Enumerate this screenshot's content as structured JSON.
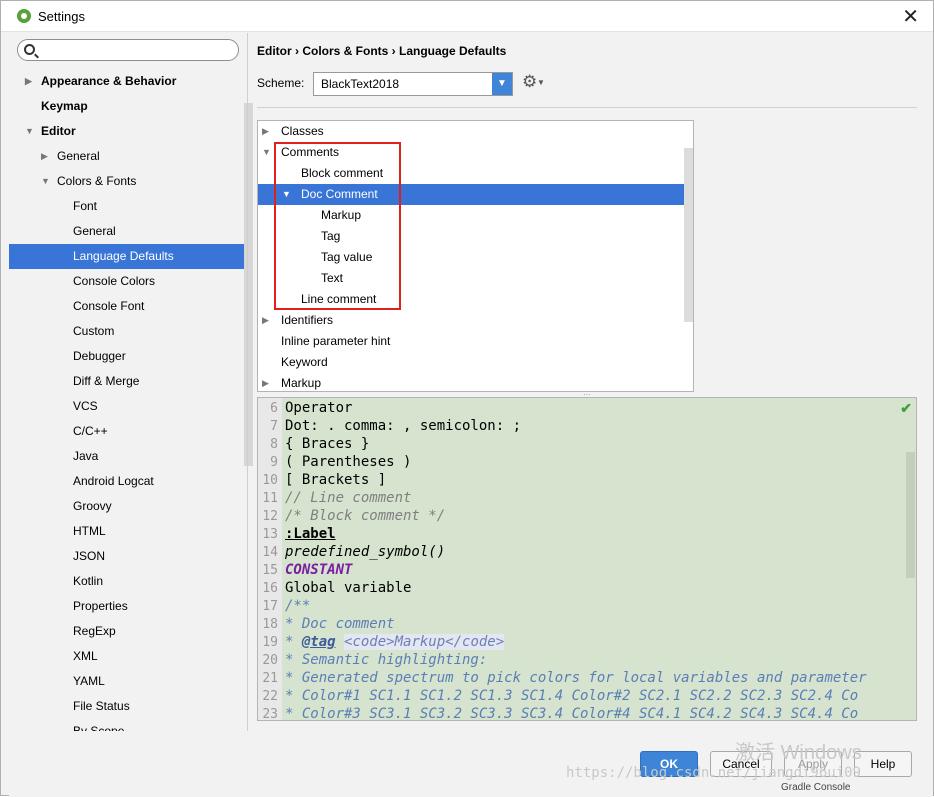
{
  "window": {
    "title": "Settings"
  },
  "search": {
    "placeholder": ""
  },
  "sidebar": {
    "items": [
      {
        "label": "Appearance & Behavior",
        "indent": 0,
        "arrow": "right",
        "bold": true
      },
      {
        "label": "Keymap",
        "indent": 0,
        "arrow": "",
        "bold": true
      },
      {
        "label": "Editor",
        "indent": 0,
        "arrow": "down",
        "bold": true
      },
      {
        "label": "General",
        "indent": 1,
        "arrow": "right"
      },
      {
        "label": "Colors & Fonts",
        "indent": 1,
        "arrow": "down"
      },
      {
        "label": "Font",
        "indent": 2
      },
      {
        "label": "General",
        "indent": 2
      },
      {
        "label": "Language Defaults",
        "indent": 2,
        "selected": true
      },
      {
        "label": "Console Colors",
        "indent": 2
      },
      {
        "label": "Console Font",
        "indent": 2
      },
      {
        "label": "Custom",
        "indent": 2
      },
      {
        "label": "Debugger",
        "indent": 2
      },
      {
        "label": "Diff & Merge",
        "indent": 2
      },
      {
        "label": "VCS",
        "indent": 2
      },
      {
        "label": "C/C++",
        "indent": 2
      },
      {
        "label": "Java",
        "indent": 2
      },
      {
        "label": "Android Logcat",
        "indent": 2
      },
      {
        "label": "Groovy",
        "indent": 2
      },
      {
        "label": "HTML",
        "indent": 2
      },
      {
        "label": "JSON",
        "indent": 2
      },
      {
        "label": "Kotlin",
        "indent": 2
      },
      {
        "label": "Properties",
        "indent": 2
      },
      {
        "label": "RegExp",
        "indent": 2
      },
      {
        "label": "XML",
        "indent": 2
      },
      {
        "label": "YAML",
        "indent": 2
      },
      {
        "label": "File Status",
        "indent": 2
      },
      {
        "label": "By Scope",
        "indent": 2
      }
    ]
  },
  "main": {
    "breadcrumb": "Editor › Colors & Fonts › Language Defaults",
    "scheme_label": "Scheme:",
    "scheme_value": "BlackText2018"
  },
  "categories": [
    {
      "label": "Classes",
      "indent": 0,
      "arrow": "right"
    },
    {
      "label": "Comments",
      "indent": 0,
      "arrow": "down"
    },
    {
      "label": "Block comment",
      "indent": 1
    },
    {
      "label": "Doc Comment",
      "indent": 1,
      "arrow": "down",
      "selected": true
    },
    {
      "label": "Markup",
      "indent": 2
    },
    {
      "label": "Tag",
      "indent": 2
    },
    {
      "label": "Tag value",
      "indent": 2
    },
    {
      "label": "Text",
      "indent": 2
    },
    {
      "label": "Line comment",
      "indent": 1
    },
    {
      "label": "Identifiers",
      "indent": 0,
      "arrow": "right"
    },
    {
      "label": "Inline parameter hint",
      "indent": 0
    },
    {
      "label": "Keyword",
      "indent": 0
    },
    {
      "label": "Markup",
      "indent": 0,
      "arrow": "right"
    }
  ],
  "preview": {
    "lines": [
      {
        "n": "6",
        "parts": [
          {
            "t": "Operator",
            "c": ""
          }
        ]
      },
      {
        "n": "7",
        "parts": [
          {
            "t": "Dot: . comma: , semicolon: ;",
            "c": ""
          }
        ]
      },
      {
        "n": "8",
        "parts": [
          {
            "t": "{ Braces }",
            "c": ""
          }
        ]
      },
      {
        "n": "9",
        "parts": [
          {
            "t": "( Parentheses )",
            "c": ""
          }
        ]
      },
      {
        "n": "10",
        "parts": [
          {
            "t": "[ Brackets ]",
            "c": ""
          }
        ]
      },
      {
        "n": "11",
        "parts": [
          {
            "t": "// Line comment",
            "c": "cmt"
          }
        ]
      },
      {
        "n": "12",
        "parts": [
          {
            "t": "/* Block comment */",
            "c": "cmt"
          }
        ]
      },
      {
        "n": "13",
        "parts": [
          {
            "t": ":Label",
            "c": "lbl"
          }
        ]
      },
      {
        "n": "14",
        "parts": [
          {
            "t": "predefined_symbol()",
            "c": "cmtitalic"
          }
        ]
      },
      {
        "n": "15",
        "parts": [
          {
            "t": "CONSTANT",
            "c": "const"
          }
        ]
      },
      {
        "n": "16",
        "parts": [
          {
            "t": "Global variable",
            "c": ""
          }
        ]
      },
      {
        "n": "17",
        "parts": [
          {
            "t": "/**",
            "c": "docl"
          }
        ]
      },
      {
        "n": "18",
        "parts": [
          {
            "t": " * Doc comment",
            "c": "docl"
          }
        ]
      },
      {
        "n": "19",
        "parts": [
          {
            "t": " * ",
            "c": "docl"
          },
          {
            "t": "@tag",
            "c": "tagname"
          },
          {
            "t": " ",
            "c": "docl"
          },
          {
            "t": "<code>Markup</code>",
            "c": "tagc"
          }
        ]
      },
      {
        "n": "20",
        "parts": [
          {
            "t": " * Semantic highlighting:",
            "c": "docl"
          }
        ]
      },
      {
        "n": "21",
        "parts": [
          {
            "t": " * Generated spectrum to pick colors for local variables and parameter",
            "c": "docl"
          }
        ]
      },
      {
        "n": "22",
        "parts": [
          {
            "t": " *  Color#1 SC1.1 SC1.2 SC1.3 SC1.4 Color#2 SC2.1 SC2.2 SC2.3 SC2.4 Co",
            "c": "docl"
          }
        ]
      },
      {
        "n": "23",
        "parts": [
          {
            "t": " *  Color#3 SC3.1 SC3.2 SC3.3 SC3.4 Color#4 SC4.1 SC4.2 SC4.3 SC4.4 Co",
            "c": "docl"
          }
        ]
      }
    ]
  },
  "buttons": {
    "ok": "OK",
    "cancel": "Cancel",
    "apply": "Apply",
    "help": "Help"
  },
  "watermark": {
    "activate": "激活 Windows",
    "url": "https://blog.csdn.net/jiangdi96ui09"
  },
  "status": {
    "bottom": "Gradle Console"
  }
}
